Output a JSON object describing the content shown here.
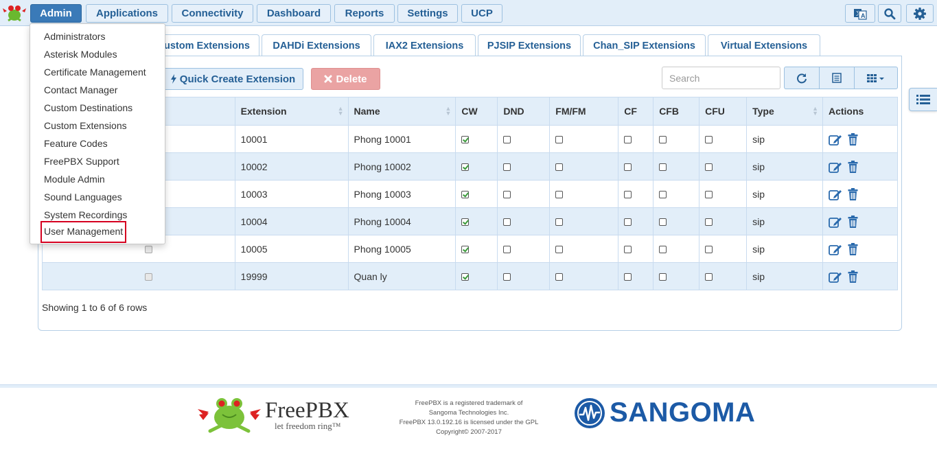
{
  "nav": {
    "items": [
      {
        "label": "Admin"
      },
      {
        "label": "Applications"
      },
      {
        "label": "Connectivity"
      },
      {
        "label": "Dashboard"
      },
      {
        "label": "Reports"
      },
      {
        "label": "Settings"
      },
      {
        "label": "UCP"
      }
    ],
    "active": "Admin",
    "icons": [
      "language-icon",
      "search-icon",
      "gear-icon"
    ]
  },
  "admin_menu": {
    "items": [
      "Administrators",
      "Asterisk Modules",
      "Certificate Management",
      "Contact Manager",
      "Custom Destinations",
      "Custom Extensions",
      "Feature Codes",
      "FreePBX Support",
      "Module Admin",
      "Sound Languages",
      "System Recordings",
      "User Management"
    ],
    "highlighted": "User Management"
  },
  "tabs": [
    "ustom Extensions",
    "DAHDi Extensions",
    "IAX2 Extensions",
    "PJSIP Extensions",
    "Chan_SIP Extensions",
    "Virtual Extensions"
  ],
  "toolbar": {
    "quick_create_label": "Quick Create Extension",
    "delete_label": "Delete",
    "search_placeholder": "Search"
  },
  "table": {
    "columns": [
      "Extension",
      "Name",
      "CW",
      "DND",
      "FM/FM",
      "CF",
      "CFB",
      "CFU",
      "Type",
      "Actions"
    ],
    "rows": [
      {
        "extension": "10001",
        "name": "Phong 10001",
        "cw": true,
        "dnd": false,
        "fmfm": false,
        "cf": false,
        "cfb": false,
        "cfu": false,
        "type": "sip"
      },
      {
        "extension": "10002",
        "name": "Phong 10002",
        "cw": true,
        "dnd": false,
        "fmfm": false,
        "cf": false,
        "cfb": false,
        "cfu": false,
        "type": "sip"
      },
      {
        "extension": "10003",
        "name": "Phong 10003",
        "cw": true,
        "dnd": false,
        "fmfm": false,
        "cf": false,
        "cfb": false,
        "cfu": false,
        "type": "sip"
      },
      {
        "extension": "10004",
        "name": "Phong 10004",
        "cw": true,
        "dnd": false,
        "fmfm": false,
        "cf": false,
        "cfb": false,
        "cfu": false,
        "type": "sip"
      },
      {
        "extension": "10005",
        "name": "Phong 10005",
        "cw": true,
        "dnd": false,
        "fmfm": false,
        "cf": false,
        "cfb": false,
        "cfu": false,
        "type": "sip"
      },
      {
        "extension": "19999",
        "name": "Quan ly",
        "cw": true,
        "dnd": false,
        "fmfm": false,
        "cf": false,
        "cfb": false,
        "cfu": false,
        "type": "sip"
      }
    ],
    "footer": "Showing 1 to 6 of 6 rows"
  },
  "footer": {
    "freepbx_title": "FreePBX",
    "freepbx_tagline": "let freedom ring™",
    "legal": [
      "FreePBX is a registered trademark of",
      "Sangoma Technologies Inc.",
      "FreePBX 13.0.192.16 is licensed under the GPL",
      "Copyright© 2007-2017"
    ],
    "sangoma": "SANGOMA"
  },
  "colors": {
    "accent": "#3a7ab8",
    "nav_bg": "#e2eef9",
    "link": "#245f95",
    "delete": "#eaa3a3",
    "highlight": "#d5001f"
  }
}
